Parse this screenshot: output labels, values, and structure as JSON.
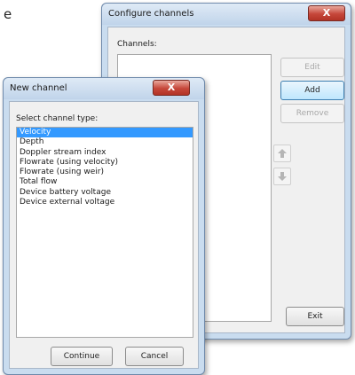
{
  "stray_text": "e",
  "configure_channels": {
    "title": "Configure channels",
    "close_label": "X",
    "channels_label": "Channels:",
    "buttons": {
      "edit": "Edit",
      "add": "Add",
      "remove": "Remove",
      "exit": "Exit"
    },
    "move_up_icon": "up-arrow",
    "move_down_icon": "down-arrow"
  },
  "new_channel": {
    "title": "New channel",
    "close_label": "X",
    "select_label": "Select channel type:",
    "options": [
      "Velocity",
      "Depth",
      "Doppler stream index",
      "Flowrate (using velocity)",
      "Flowrate (using weir)",
      "Total flow",
      "Device battery voltage",
      "Device external voltage"
    ],
    "selected_option": "Velocity",
    "buttons": {
      "continue": "Continue",
      "cancel": "Cancel"
    }
  },
  "colors": {
    "title_bar": "#c9dcef",
    "close_button": "#c6473a",
    "selection": "#3399ff"
  }
}
